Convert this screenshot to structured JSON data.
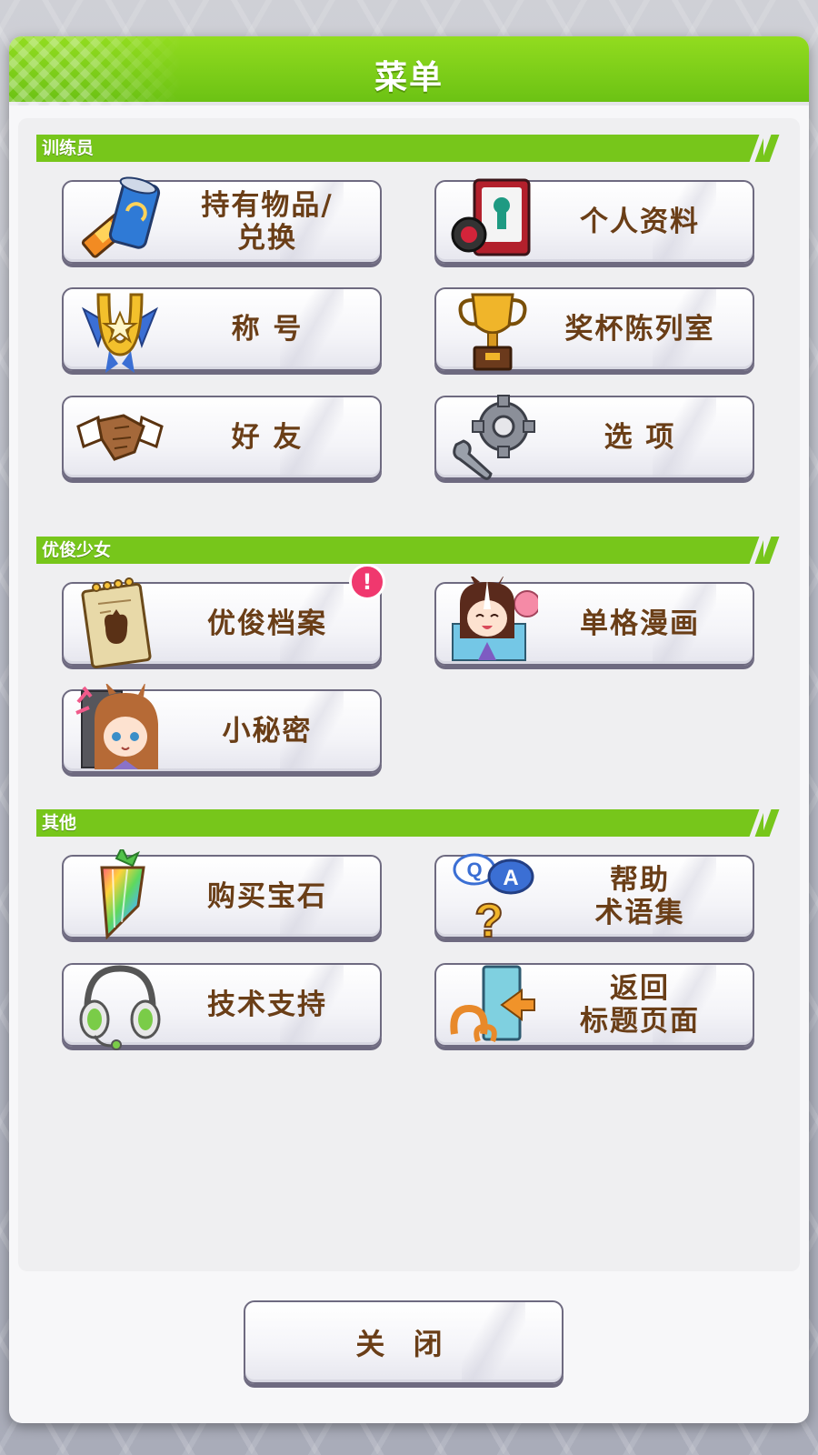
{
  "dialog": {
    "title": "菜单",
    "close_label": "关 闭"
  },
  "sections": {
    "trainer": {
      "label": "训练员",
      "items": {
        "items_exchange": "持有物品/\n兑换",
        "profile": "个人资料",
        "title": "称 号",
        "trophy_room": "奖杯陈列室",
        "friends": "好 友",
        "options": "选 项"
      }
    },
    "umamusume": {
      "label": "优俊少女",
      "items": {
        "uma_archive": "优俊档案",
        "single_manga": "单格漫画",
        "secrets": "小秘密"
      },
      "notification_badge": "!"
    },
    "other": {
      "label": "其他",
      "items": {
        "buy_gems": "购买宝石",
        "help_glossary": "帮助\n术语集",
        "tech_support": "技术支持",
        "return_title": "返回\n标题页面"
      }
    }
  },
  "colors": {
    "accent_green": "#77c61b",
    "label_brown": "#6a3e17",
    "badge_pink": "#f0386e",
    "button_border": "#6e6a80"
  },
  "icons": {
    "items_exchange": "snack-and-drink-can-icon",
    "profile": "trainer-card-icon",
    "title": "horseshoe-medal-icon",
    "trophy_room": "trophy-icon",
    "friends": "handshake-icon",
    "options": "gear-wrench-icon",
    "uma_archive": "notebook-icon",
    "single_manga": "chibi-manga-icon",
    "secrets": "chibi-secret-icon",
    "buy_gems": "rainbow-gem-icon",
    "help_glossary": "qa-bubble-icon",
    "tech_support": "headset-icon",
    "return_title": "exit-door-icon"
  }
}
